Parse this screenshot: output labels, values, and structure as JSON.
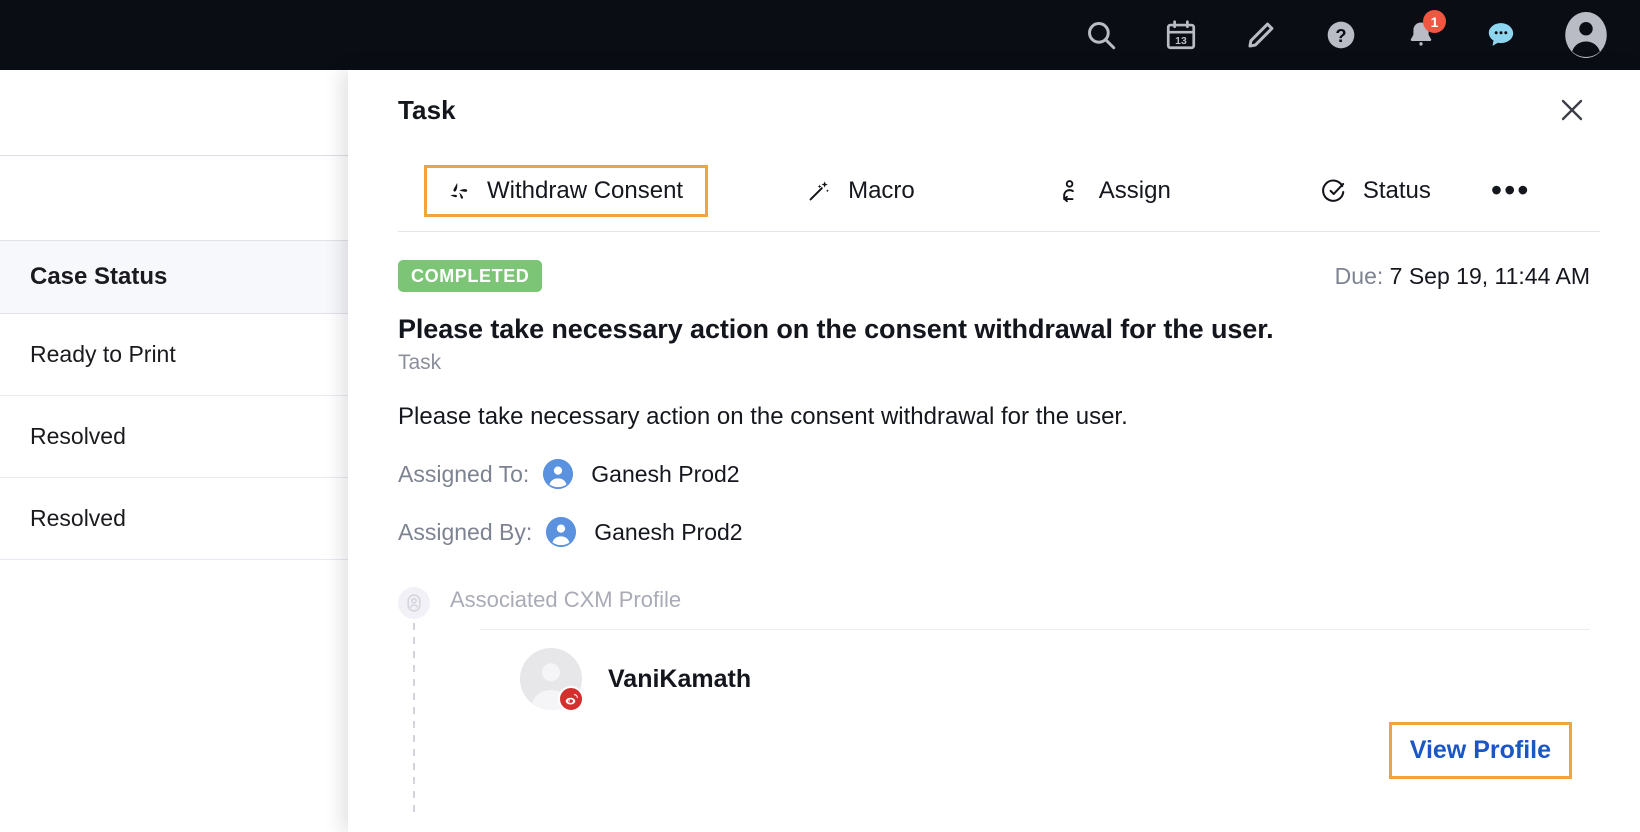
{
  "topbar": {
    "background": "#0b0d14",
    "icons": [
      {
        "name": "search-icon",
        "label": "Search"
      },
      {
        "name": "calendar-icon",
        "label": "Calendar",
        "day": "13"
      },
      {
        "name": "pencil-icon",
        "label": "Compose"
      },
      {
        "name": "help-icon",
        "label": "Help"
      },
      {
        "name": "bell-icon",
        "label": "Notifications",
        "badge": "1",
        "badge_color": "#f05740"
      },
      {
        "name": "chat-icon",
        "label": "Chat",
        "color": "#8ed5ef"
      },
      {
        "name": "avatar-icon",
        "label": "Profile"
      }
    ]
  },
  "background_table": {
    "header": "Case Status",
    "rows": [
      "Ready to Print",
      "Resolved",
      "Resolved"
    ]
  },
  "panel": {
    "title": "Task",
    "close_label": "✕",
    "toolbar": {
      "withdraw_consent": "Withdraw Consent",
      "macro": "Macro",
      "assign": "Assign",
      "status": "Status",
      "more": "•••",
      "highlight_color": "#f0a33f"
    },
    "status_badge": {
      "text": "COMPLETED",
      "color": "#7cc576"
    },
    "due": {
      "label": "Due:",
      "value": "7 Sep 19, 11:44 AM"
    },
    "task_title": "Please take necessary action on the consent withdrawal for the user.",
    "task_subtitle": "Task",
    "task_description": "Please take necessary action on the consent withdrawal for the user.",
    "assigned_to": {
      "label": "Assigned To:",
      "name": "Ganesh Prod2"
    },
    "assigned_by": {
      "label": "Assigned By:",
      "name": "Ganesh Prod2"
    },
    "cxm": {
      "section_label": "Associated CXM Profile",
      "person_name": "VaniKamath",
      "channel_badge_color": "#d32f2f",
      "view_profile": "View Profile",
      "view_profile_color": "#1a56c4"
    }
  }
}
